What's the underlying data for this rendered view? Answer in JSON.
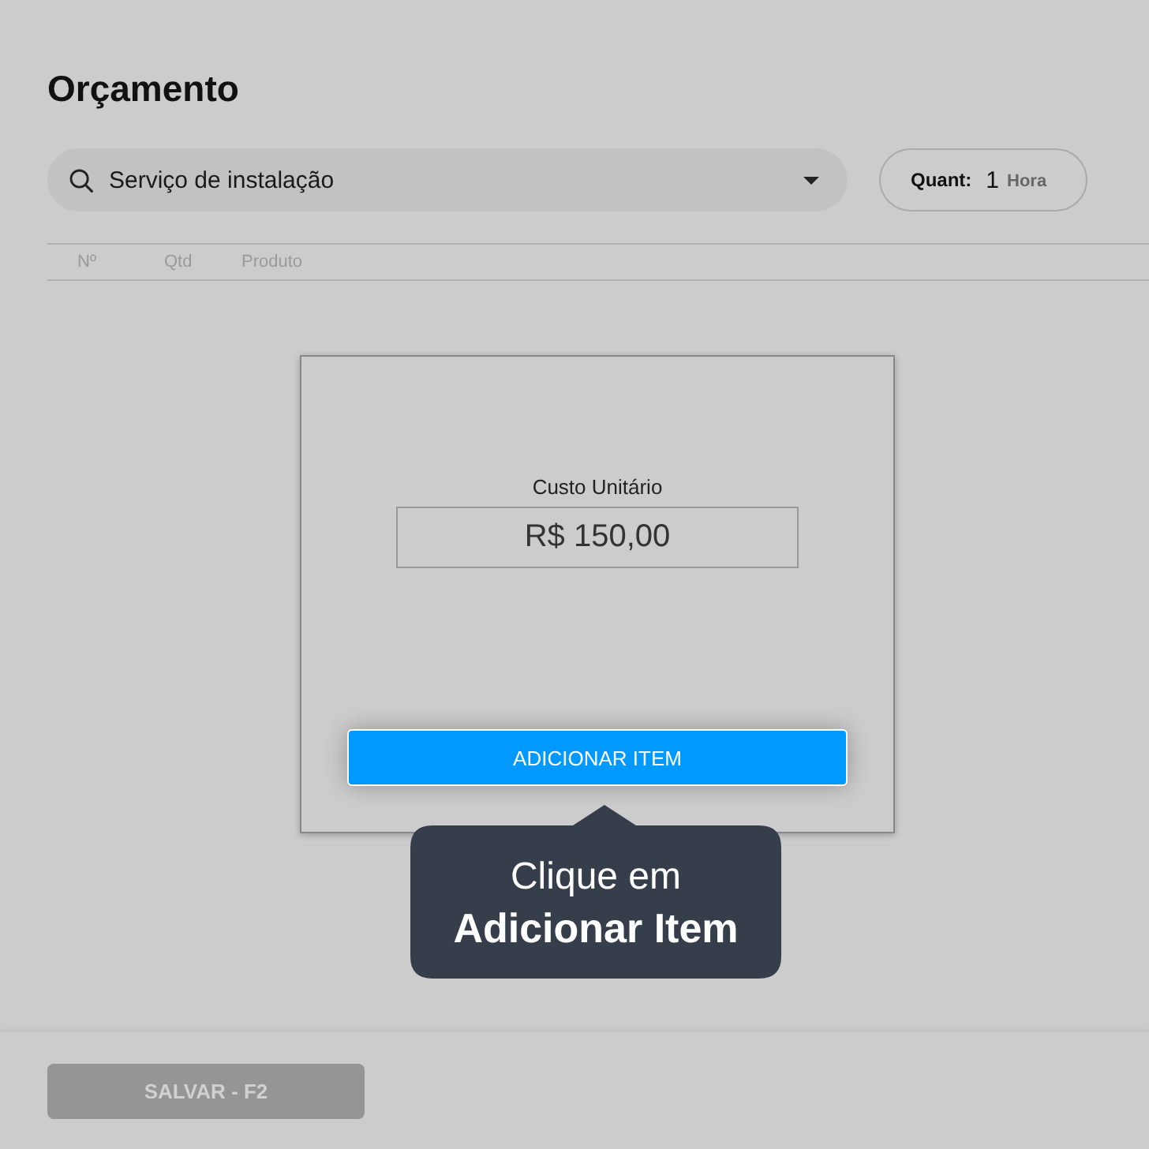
{
  "page": {
    "title": "Orçamento"
  },
  "product_select": {
    "value": "Serviço de instalação"
  },
  "quantity": {
    "label": "Quant:",
    "value": "1",
    "unit": "Hora"
  },
  "table": {
    "columns": [
      "Nº",
      "Qtd",
      "Produto"
    ]
  },
  "dialog": {
    "field_label": "Custo Unitário",
    "unit_cost": "R$ 150,00",
    "button": "ADICIONAR ITEM"
  },
  "tooltip": {
    "text": "Clique em **Adicionar Item**"
  },
  "footer": {
    "save_button": {
      "label": "SALVAR - F2",
      "disabled": true
    }
  }
}
